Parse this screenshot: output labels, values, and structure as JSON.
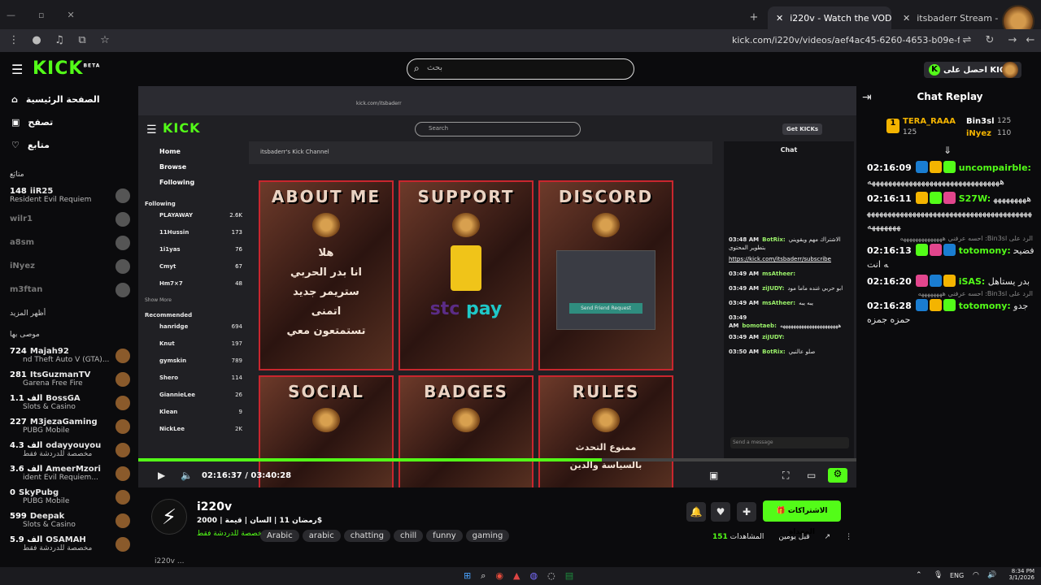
{
  "browser": {
    "tabs": [
      {
        "label": "i220v - Watch the VOD on Kick",
        "active": true
      },
      {
        "label": "itsbaderr Stream - Watch Live o",
        "active": false
      }
    ],
    "url": "kick.com/i220v/videos/aef4ac45-6260-4653-b09e-f77d9d2bbeae"
  },
  "header": {
    "logo": "KICK",
    "logo_sup": "BETA",
    "search_placeholder": "بحث",
    "get_kicks": "احصل على KICKs"
  },
  "sidebar": {
    "nav": [
      {
        "label": "الصفحة الرئيسية",
        "icon": "home-icon"
      },
      {
        "label": "تصفح",
        "icon": "browse-icon"
      },
      {
        "label": "متابع",
        "icon": "heart-icon"
      }
    ],
    "following_title": "متابَع",
    "following": [
      {
        "name": "iiR25",
        "count": "148",
        "sub": "Resident Evil Requiem",
        "live": true
      },
      {
        "name": "wilr1",
        "count": "",
        "sub": "",
        "live": false
      },
      {
        "name": "a8sm",
        "count": "",
        "sub": "",
        "live": false
      },
      {
        "name": "iNyez",
        "count": "",
        "sub": "",
        "live": false
      },
      {
        "name": "m3ftan",
        "count": "",
        "sub": "",
        "live": false
      }
    ],
    "show_more": "أظهر المزيد",
    "recommended_title": "موصى بها",
    "recommended": [
      {
        "name": "Majah92",
        "count": "724",
        "sub": "nd Theft Auto V (GTA)..."
      },
      {
        "name": "ItsGuzmanTV",
        "count": "281",
        "sub": "Garena Free Fire"
      },
      {
        "name": "BossGA",
        "count": "1.1 ألف",
        "sub": "Slots & Casino"
      },
      {
        "name": "M3jezaGaming",
        "count": "227",
        "sub": "PUBG Mobile"
      },
      {
        "name": "odayyouyou",
        "count": "4.3 ألف",
        "sub": "مخصصة للدردشة فقط"
      },
      {
        "name": "AmeerMzori",
        "count": "3.6 ألف",
        "sub": "ident Evil Requiem..."
      },
      {
        "name": "SkyPubg",
        "count": "0",
        "sub": "PUBG Mobile"
      },
      {
        "name": "Deepak",
        "count": "599",
        "sub": "Slots & Casino"
      },
      {
        "name": "OSAMAH",
        "count": "5.9 ألف",
        "sub": "مخصصة للدردشة فقط"
      }
    ]
  },
  "video": {
    "inner_url": "kick.com/itsbaderr",
    "inner_search": "Search",
    "inner_get_kicks": "Get KICKs",
    "inner_channel": "itsbaderr's Kick Channel",
    "inner_chat": "Chat",
    "inner_nav": [
      "Home",
      "Browse",
      "Following"
    ],
    "inner_following_title": "Following",
    "inner_following": [
      {
        "name": "PLAYAWAY",
        "v": "2.6K"
      },
      {
        "name": "11Hussin",
        "v": "173"
      },
      {
        "name": "1i1yas",
        "v": "76"
      },
      {
        "name": "Cmyt",
        "v": "67"
      },
      {
        "name": "Hm7×7",
        "v": "48"
      }
    ],
    "inner_show_more": "Show More",
    "inner_recommended_title": "Recommended",
    "inner_recommended": [
      {
        "name": "hanridge",
        "v": "694"
      },
      {
        "name": "Knut",
        "v": "197"
      },
      {
        "name": "gymskin",
        "v": "789"
      },
      {
        "name": "Shero",
        "v": "114"
      },
      {
        "name": "GiannieLee",
        "v": "26"
      },
      {
        "name": "Klean",
        "v": "9"
      },
      {
        "name": "NickLee",
        "v": "2K"
      }
    ],
    "panels": [
      "ABOUT ME",
      "SUPPORT",
      "DISCORD",
      "SOCIAL",
      "BADGES",
      "RULES"
    ],
    "about_text": "هلا\nانا بدر الحربي\nستريمر جديد\nاتمنى\nتستمتعون معي",
    "rules_text": "ممنوع التحدث\nبالسياسة والدين",
    "discord_button": "Send Friend Request",
    "inner_chat_lines": [
      {
        "time": "03:48 AM",
        "user": "BotRix:",
        "text": "الاشتراك مهم ويقويني بتطوير المحتوى"
      },
      {
        "time": "",
        "user": "",
        "text": "https://kick.com/itsbaderr/subscribe"
      },
      {
        "time": "03:49 AM",
        "user": "msAtheer:",
        "text": ""
      },
      {
        "time": "03:49 AM",
        "user": "ziJUDY:",
        "text": "ابو حربي غنده ماما مود"
      },
      {
        "time": "03:49 AM",
        "user": "msAtheer:",
        "text": "يبه يبه"
      },
      {
        "time": "03:49 AM",
        "user": "bomotaeb:",
        "text": "ههههههههههههههههههههههه"
      },
      {
        "time": "03:49 AM",
        "user": "ziJUDY:",
        "text": ""
      },
      {
        "time": "03:50 AM",
        "user": "BotRix:",
        "text": "صلو عالنبي"
      }
    ],
    "inner_send": "Send a message",
    "time_current": "02:16:37",
    "time_total": "03:40:28",
    "progress": 0.645
  },
  "info": {
    "channel": "i220v",
    "title": "رمضان 11 | السان | قيمة | 2000$",
    "category": "مخصصة للدردشة فقط",
    "tags": [
      "Arabic",
      "arabic",
      "chatting",
      "chill",
      "funny",
      "gaming"
    ],
    "subscribe_label": "الاشتراكات المهداة",
    "views": "151",
    "views_label": "المشاهدات",
    "ago": "قبل يومين",
    "desc": "i220v ..."
  },
  "chat": {
    "title": "Chat Replay",
    "gifters": [
      {
        "name": "TERA_RAAA",
        "value": "125"
      },
      {
        "name": "Bin3sl",
        "value": "125"
      },
      {
        "name": "iNyez",
        "value": "110"
      }
    ],
    "messages": [
      {
        "time": "02:16:09",
        "user": "uncompairble:",
        "text": "ههههههههههههههههههههههههههههههههه",
        "reply": ""
      },
      {
        "time": "02:16:11",
        "user": "S27W:",
        "text": "ههههههههههههههههههههههههههههههههههههههههههههههههههههههههه",
        "reply": ""
      },
      {
        "time": "02:16:13",
        "user": "totomony:",
        "text": "فضيحه انت",
        "reply": "الرد على Bin3sl: احسه عرفني ههههههههههههههه"
      },
      {
        "time": "02:16:20",
        "user": "iSAS:",
        "text": "بدر يستاهل",
        "reply": ""
      },
      {
        "time": "02:16:28",
        "user": "totomony:",
        "text": "جدو حمزه جمزه",
        "reply": "الرد على Bin3sl: احسه عرفني ههههههههه"
      }
    ]
  },
  "taskbar": {
    "lang": "ENG",
    "time": "8:34 PM",
    "date": "3/1/2026"
  },
  "colors": {
    "kick_green": "#53fc18",
    "dark": "#0b0b0d",
    "red": "#c9262e"
  }
}
